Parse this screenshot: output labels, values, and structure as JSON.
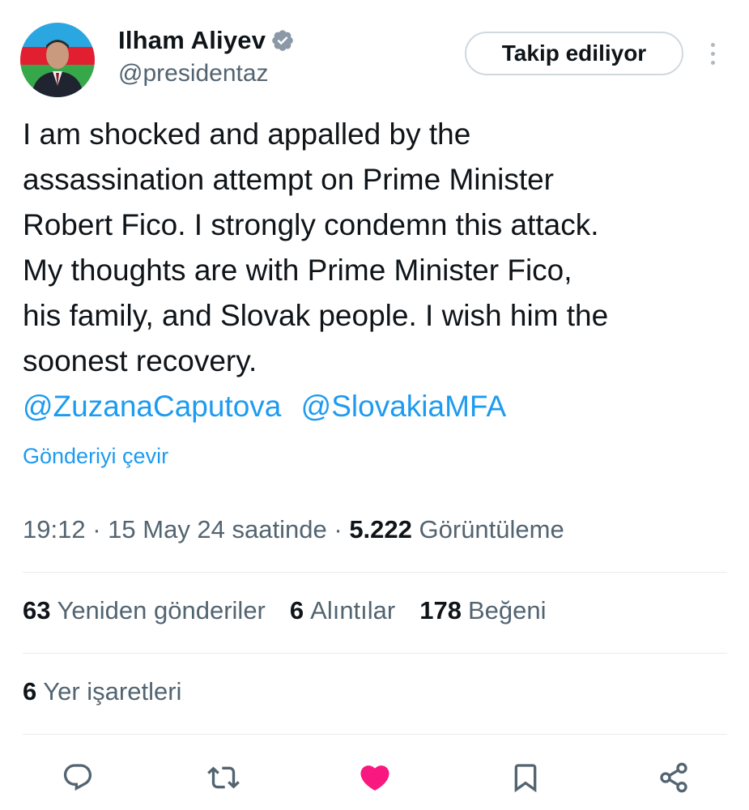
{
  "author": {
    "display_name": "Ilham Aliyev",
    "handle": "@presidentaz",
    "verified": true
  },
  "follow_button": {
    "label": "Takip ediliyor"
  },
  "tweet": {
    "lines": [
      "I am shocked and appalled by the",
      "assassination attempt on Prime Minister",
      "Robert Fico. I strongly condemn this attack.",
      "My thoughts are with Prime Minister Fico,",
      "his family, and Slovak people. I wish him the",
      "soonest recovery."
    ],
    "mentions": [
      "@ZuzanaCaputova",
      "@SlovakiaMFA"
    ]
  },
  "translate_label": "Gönderiyi çevir",
  "meta": {
    "time": "19:12",
    "separator": "·",
    "date": "15 May 24 saatinde",
    "views_count": "5.222",
    "views_label": "Görüntüleme"
  },
  "stats": {
    "reposts": {
      "count": "63",
      "label": "Yeniden gönderiler"
    },
    "quotes": {
      "count": "6",
      "label": "Alıntılar"
    },
    "likes": {
      "count": "178",
      "label": "Beğeni"
    },
    "bookmarks": {
      "count": "6",
      "label": "Yer işaretleri"
    }
  },
  "actions": [
    {
      "name": "reply-icon"
    },
    {
      "name": "repost-icon"
    },
    {
      "name": "like-icon",
      "active": true
    },
    {
      "name": "bookmark-icon"
    },
    {
      "name": "share-icon"
    }
  ],
  "colors": {
    "accent": "#1d9bf0",
    "like_active": "#f91880",
    "text": "#0f1419",
    "secondary": "#536471"
  }
}
